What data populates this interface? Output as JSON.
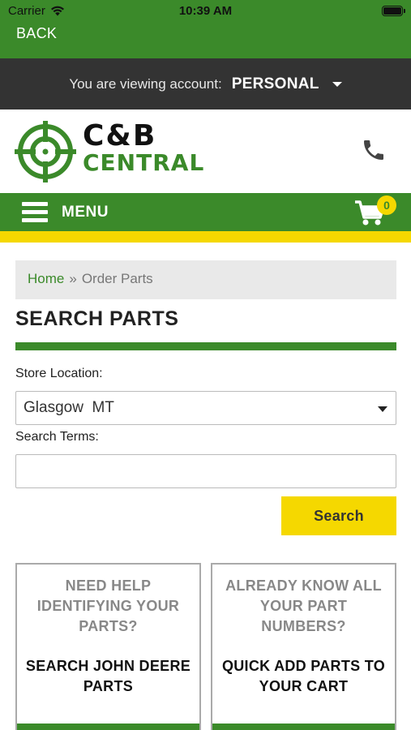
{
  "status_bar": {
    "carrier": "Carrier",
    "time": "10:39 AM"
  },
  "nav": {
    "back_label": "BACK"
  },
  "account": {
    "prefix": "You are viewing account:",
    "name": "PERSONAL"
  },
  "brand": {
    "line1": "C&B",
    "line2": "CENTRAL"
  },
  "menu": {
    "label": "MENU",
    "cart_count": "0"
  },
  "breadcrumb": {
    "home": "Home",
    "separator": "»",
    "current": "Order Parts"
  },
  "page": {
    "title": "SEARCH PARTS"
  },
  "form": {
    "store_label": "Store Location:",
    "store_value": "Glasgow  MT",
    "terms_label": "Search Terms:",
    "terms_value": "",
    "search_button": "Search"
  },
  "cards": [
    {
      "question": "NEED HELP IDENTIFYING YOUR PARTS?",
      "action": "SEARCH JOHN DEERE PARTS"
    },
    {
      "question": "ALREADY KNOW ALL YOUR PART NUMBERS?",
      "action": "QUICK ADD PARTS TO YOUR CART"
    }
  ],
  "colors": {
    "brand_green": "#3b8a2a",
    "accent_yellow": "#f5d800",
    "account_bar": "#333333"
  }
}
